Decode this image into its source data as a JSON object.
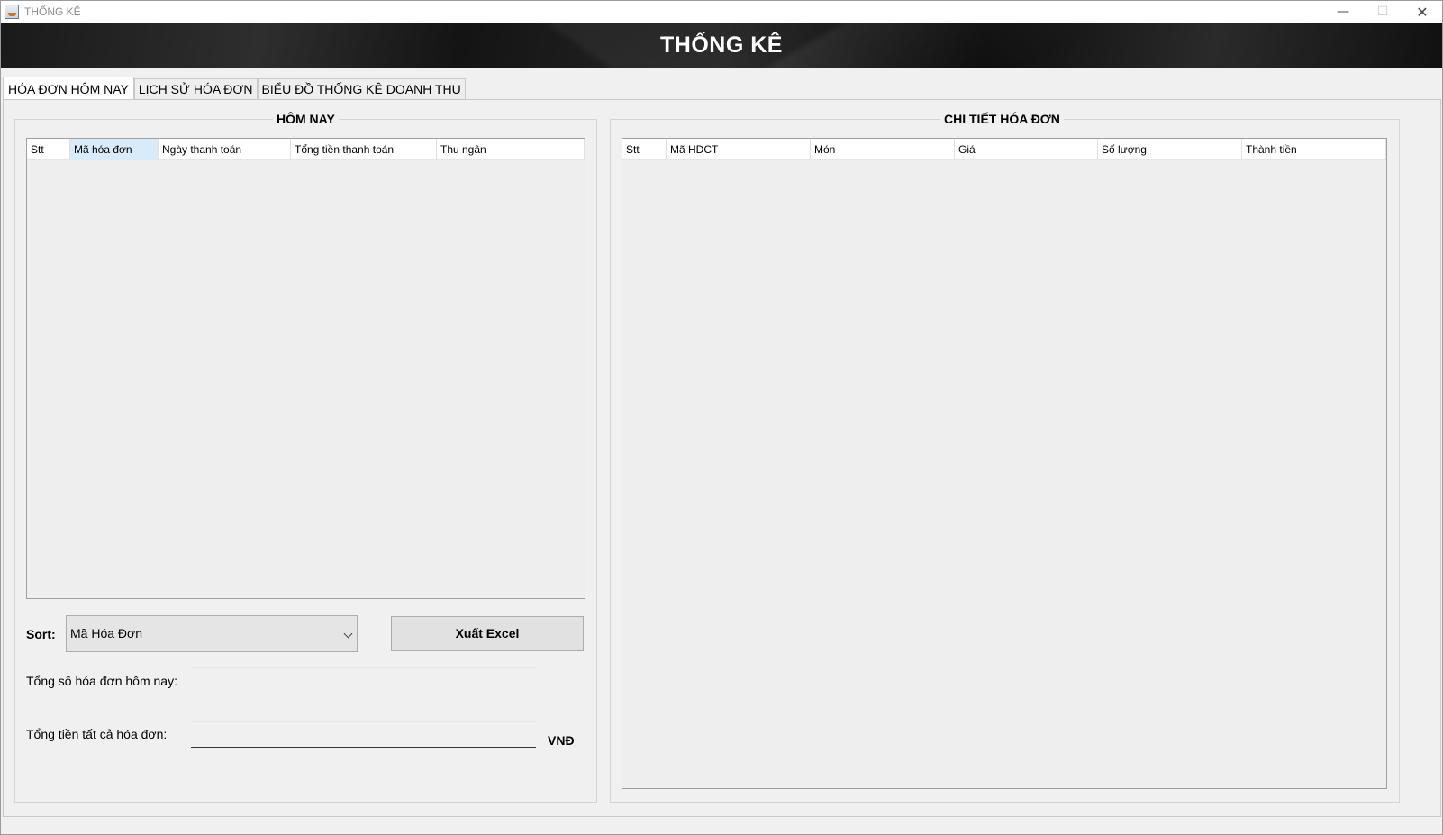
{
  "window": {
    "title": "THỐNG KÊ",
    "controls": {
      "minimize": "—",
      "maximize": "☐",
      "close": "✕"
    }
  },
  "banner": {
    "title": "THỐNG KÊ"
  },
  "tabs": [
    {
      "label": "HÓA ĐƠN HÔM NAY",
      "active": true
    },
    {
      "label": "LỊCH SỬ HÓA ĐƠN",
      "active": false
    },
    {
      "label": "BIỂU ĐỒ THỐNG KÊ DOANH THU",
      "active": false
    }
  ],
  "left_panel": {
    "title": "HÔM NAY",
    "table": {
      "columns": [
        "Stt",
        "Mã hóa đơn",
        "Ngày thanh toán",
        "Tổng tiền thanh toán",
        "Thu ngân"
      ],
      "selected_column": "Mã hóa đơn",
      "rows": []
    },
    "sort": {
      "label": "Sort:",
      "selected": "Mã Hóa Đơn"
    },
    "export_button": "Xuất Excel",
    "count_label": "Tổng số hóa đơn hôm nay:",
    "count_value": "",
    "total_label": "Tổng tiền tất cả hóa đơn:",
    "total_value": "",
    "currency": "VNĐ"
  },
  "right_panel": {
    "title": "CHI TIẾT HÓA ĐƠN",
    "table": {
      "columns": [
        "Stt",
        "Mã HDCT",
        "Món",
        "Giá",
        "Số lượng",
        "Thành tiền"
      ],
      "rows": []
    }
  },
  "colors": {
    "banner_bg": "#1a1a1a",
    "banner_text": "#ffffff",
    "window_bg": "#f0f0f0",
    "selected_header": "#d9ebf9"
  }
}
